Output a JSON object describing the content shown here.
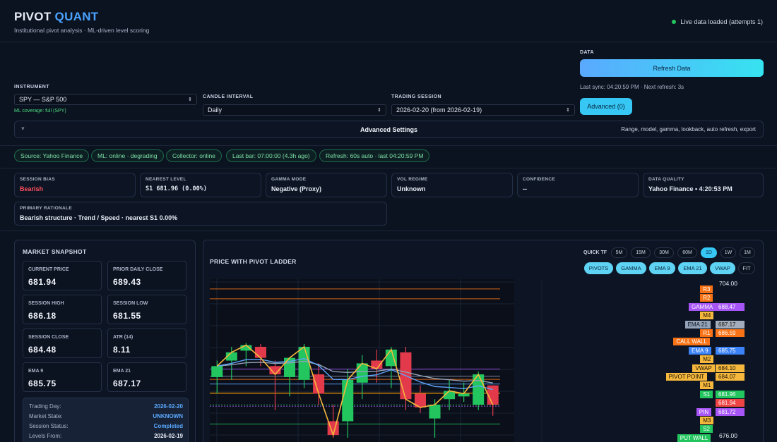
{
  "header": {
    "brand_a": "PIVOT",
    "brand_b": "QUANT",
    "tagline": "Institutional pivot analysis · ML-driven level scoring",
    "live_status": "Live data loaded (attempts 1)"
  },
  "controls": {
    "instrument_label": "INSTRUMENT",
    "instrument_value": "SPY — S&P 500",
    "ml_coverage": "ML coverage: full (SPY)",
    "interval_label": "CANDLE INTERVAL",
    "interval_value": "Daily",
    "session_label": "TRADING SESSION",
    "session_value": "2026-02-20 (from 2026-02-19)",
    "data_label": "DATA",
    "refresh_label": "Refresh Data",
    "last_sync": "Last sync: 04:20:59 PM · Next refresh: 3s",
    "advanced_button": "Advanced (0)",
    "adv_settings_chev": "˅",
    "adv_settings_title": "Advanced Settings",
    "adv_settings_hint": "Range, model, gamma, lookback, auto refresh, export"
  },
  "status_pills": [
    "Source: Yahoo Finance",
    "ML: online · degrading",
    "Collector: online",
    "Last bar: 07:00:00 (4.3h ago)",
    "Refresh: 60s auto · last 04:20:59 PM"
  ],
  "metrics": [
    {
      "title": "SESSION BIAS",
      "value": "Bearish",
      "color": "#ff4d5e"
    },
    {
      "title": "NEAREST LEVEL",
      "value": "S1 681.96 (0.00%)",
      "color": "#e6ebf5"
    },
    {
      "title": "GAMMA MODE",
      "value": "Negative (Proxy)",
      "color": "#e6ebf5"
    },
    {
      "title": "VOL REGIME",
      "value": "Unknown",
      "color": "#e6ebf5"
    },
    {
      "title": "CONFIDENCE",
      "value": "--",
      "color": "#e6ebf5"
    },
    {
      "title": "DATA QUALITY",
      "value": "Yahoo Finance • 4:20:53 PM",
      "color": "#e6ebf5"
    }
  ],
  "rationale": {
    "title": "PRIMARY RATIONALE",
    "value": "Bearish structure · Trend / Speed · nearest S1 0.00%"
  },
  "snapshot": {
    "title": "MARKET SNAPSHOT",
    "boxes": [
      {
        "title": "CURRENT PRICE",
        "value": "681.94"
      },
      {
        "title": "PRIOR DAILY CLOSE",
        "value": "689.43"
      },
      {
        "title": "SESSION HIGH",
        "value": "686.18"
      },
      {
        "title": "SESSION LOW",
        "value": "681.55"
      },
      {
        "title": "SESSION CLOSE",
        "value": "684.48"
      },
      {
        "title": "ATR (14)",
        "value": "8.11"
      },
      {
        "title": "EMA 9",
        "value": "685.75"
      },
      {
        "title": "EMA 21",
        "value": "687.17"
      }
    ],
    "info": [
      {
        "k": "Trading Day:",
        "v": "2026-02-20",
        "color": "#5aa9ff"
      },
      {
        "k": "Market State:",
        "v": "UNKNOWN",
        "color": "#5aa9ff"
      },
      {
        "k": "Session Status:",
        "v": "Completed",
        "color": "#5aa9ff"
      },
      {
        "k": "Levels From:",
        "v": "2026-02-19",
        "color": "#e6ebf5"
      }
    ]
  },
  "chart_panel": {
    "title": "PRICE WITH PIVOT LADDER",
    "quick_tf_label": "QUICK TF",
    "timeframes": [
      "5M",
      "15M",
      "30M",
      "60M",
      "1D",
      "1W",
      "1M"
    ],
    "active_tf": "1D",
    "overlays": [
      "PIVOTS",
      "GAMMA",
      "EMA 9",
      "EMA 21",
      "VWAP",
      "FIT"
    ]
  },
  "chart_data": {
    "type": "candlestick",
    "ylim": [
      676.0,
      704.0
    ],
    "y_top_label": "704.00",
    "y_bottom_label": "676.00",
    "candles": [
      {
        "o": 687.0,
        "h": 690.0,
        "l": 684.0,
        "c": 689.0
      },
      {
        "o": 690.0,
        "h": 692.5,
        "l": 686.5,
        "c": 691.5
      },
      {
        "o": 691.8,
        "h": 693.2,
        "l": 689.0,
        "c": 692.8
      },
      {
        "o": 692.5,
        "h": 693.0,
        "l": 689.0,
        "c": 690.5
      },
      {
        "o": 689.0,
        "h": 690.0,
        "l": 681.0,
        "c": 687.5
      },
      {
        "o": 687.0,
        "h": 690.5,
        "l": 683.5,
        "c": 690.5
      },
      {
        "o": 686.5,
        "h": 693.0,
        "l": 685.0,
        "c": 692.5
      },
      {
        "o": 687.5,
        "h": 689.5,
        "l": 682.0,
        "c": 684.0
      },
      {
        "o": 679.0,
        "h": 682.0,
        "l": 676.0,
        "c": 676.5
      },
      {
        "o": 679.0,
        "h": 688.5,
        "l": 676.0,
        "c": 686.5
      },
      {
        "o": 686.0,
        "h": 691.0,
        "l": 683.0,
        "c": 689.5
      },
      {
        "o": 690.0,
        "h": 692.0,
        "l": 686.0,
        "c": 688.5
      },
      {
        "o": 689.0,
        "h": 692.5,
        "l": 685.0,
        "c": 692.0
      },
      {
        "o": 691.5,
        "h": 692.5,
        "l": 681.0,
        "c": 683.0
      },
      {
        "o": 684.0,
        "h": 685.5,
        "l": 680.5,
        "c": 681.5
      },
      {
        "o": 679.5,
        "h": 683.0,
        "l": 676.0,
        "c": 682.0
      },
      {
        "o": 683.0,
        "h": 686.5,
        "l": 681.0,
        "c": 684.5
      },
      {
        "o": 683.5,
        "h": 686.0,
        "l": 682.5,
        "c": 684.0
      },
      {
        "o": 682.0,
        "h": 688.0,
        "l": 681.0,
        "c": 687.5
      },
      {
        "o": 685.5,
        "h": 685.5,
        "l": 680.0,
        "c": 682.0
      }
    ],
    "levels_lines": [
      {
        "name": "R3",
        "value": 703.0,
        "color": "#f97316"
      },
      {
        "name": "R2",
        "value": 701.2,
        "color": "#f97316"
      },
      {
        "name": "GAMMA",
        "value": 688.47,
        "color": "#a855f7"
      },
      {
        "name": "EMA 21",
        "value": 687.17,
        "color": "#94a3b8"
      },
      {
        "name": "R1",
        "value": 686.59,
        "color": "#f97316"
      },
      {
        "name": "EMA 9",
        "value": 685.75,
        "color": "#60a5fa"
      },
      {
        "name": "VWAP",
        "value": 684.1,
        "color": "#f59e0b"
      },
      {
        "name": "PIVOT POINT",
        "value": 684.07,
        "color": "#f59e0b"
      },
      {
        "name": "S1",
        "value": 681.96,
        "color": "#22c55e"
      },
      {
        "name": "PIN",
        "value": 681.72,
        "color": "#a855f7"
      },
      {
        "name": "S2",
        "value": 678.5,
        "color": "#22c55e"
      }
    ],
    "ladder": [
      {
        "name": "R3",
        "value": "",
        "color": "#f97316"
      },
      {
        "name": "R2",
        "value": "",
        "color": "#f97316"
      },
      {
        "name": "GAMMA",
        "value": "688.47",
        "color": "#a855f7",
        "vcolor": "#a855f7"
      },
      {
        "name": "M4",
        "value": "",
        "color": "#f5b83d"
      },
      {
        "name": "EMA 21",
        "value": "687.17",
        "color": "#94a3b8",
        "vcolor": "#a3adbd"
      },
      {
        "name": "R1",
        "value": "686.59",
        "color": "#f97316",
        "vcolor": "#f97316"
      },
      {
        "name": "CALL WALL",
        "value": "",
        "color": "#f97316"
      },
      {
        "name": "EMA 9",
        "value": "685.75",
        "color": "#3b82f6",
        "vcolor": "#3b82f6"
      },
      {
        "name": "M2",
        "value": "",
        "color": "#f5b83d"
      },
      {
        "name": "VWAP",
        "value": "684.10",
        "color": "#f5b83d",
        "vcolor": "#f5b83d"
      },
      {
        "name": "PIVOT POINT",
        "value": "684.07",
        "color": "#f5b83d",
        "vcolor": "#f5b83d"
      },
      {
        "name": "M1",
        "value": "",
        "color": "#f5b83d"
      },
      {
        "name": "S1",
        "value": "681.96",
        "color": "#22c55e",
        "vcolor": "#22c55e"
      },
      {
        "name": "",
        "value": "681.94",
        "color": "",
        "vcolor": "#ef4444"
      },
      {
        "name": "PIN",
        "value": "681.72",
        "color": "#a855f7",
        "vcolor": "#a855f7"
      },
      {
        "name": "M3",
        "value": "",
        "color": "#f5b83d"
      },
      {
        "name": "S2",
        "value": "",
        "color": "#22c55e"
      },
      {
        "name": "PUT WALL",
        "value": "",
        "color": "#22c55e"
      }
    ]
  },
  "colors": {
    "up": "#22c55e",
    "down": "#e23a4a",
    "accent": "#36c7f5"
  }
}
